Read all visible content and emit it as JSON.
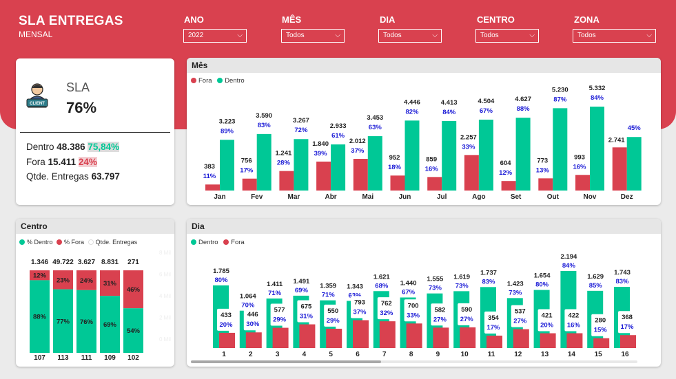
{
  "header": {
    "title": "SLA ENTREGAS",
    "subtitle": "MENSAL"
  },
  "filters": [
    {
      "label": "ANO",
      "value": "2022"
    },
    {
      "label": "MÊS",
      "value": "Todos"
    },
    {
      "label": "DIA",
      "value": "Todos"
    },
    {
      "label": "CENTRO",
      "value": "Todos"
    },
    {
      "label": "ZONA",
      "value": "Todos"
    }
  ],
  "kpi": {
    "label": "SLA",
    "value": "76%",
    "icon_text": "CLIENT",
    "dentro_label": "Dentro",
    "dentro_value": "48.386",
    "dentro_pct": "75,84%",
    "fora_label": "Fora",
    "fora_value": "15.411",
    "fora_pct": "24%",
    "total_label": "Qtde. Entregas",
    "total_value": "63.797"
  },
  "colors": {
    "dentro": "#00c896",
    "fora": "#d9414f",
    "pct": "#1a1ad6",
    "header": "#d9414f"
  },
  "month_panel": {
    "title": "Mês",
    "legend": [
      "Fora",
      "Dentro"
    ]
  },
  "centro_panel": {
    "title": "Centro",
    "legend": [
      "% Dentro",
      "% Fora",
      "Qtde. Entregas"
    ]
  },
  "day_panel": {
    "title": "Dia",
    "legend": [
      "Dentro",
      "Fora"
    ]
  },
  "chart_data": [
    {
      "type": "bar",
      "title": "Mês",
      "categories": [
        "Jan",
        "Fev",
        "Mar",
        "Abr",
        "Mai",
        "Jun",
        "Jul",
        "Ago",
        "Set",
        "Out",
        "Nov",
        "Dez"
      ],
      "series": [
        {
          "name": "Fora",
          "values": [
            383,
            756,
            1241,
            1840,
            2012,
            952,
            859,
            2257,
            604,
            773,
            993,
            2741
          ],
          "labels": [
            "383",
            "756",
            "1.241",
            "1.840",
            "2.012",
            "952",
            "859",
            "2.257",
            "604",
            "773",
            "993",
            "2.741"
          ],
          "pct": [
            "11%",
            "17%",
            "28%",
            "39%",
            "37%",
            "18%",
            "16%",
            "33%",
            "12%",
            "13%",
            "16%",
            ""
          ]
        },
        {
          "name": "Dentro",
          "values": [
            3223,
            3590,
            3267,
            2933,
            3453,
            4446,
            4413,
            4504,
            4627,
            5230,
            5332,
            3400
          ],
          "labels": [
            "3.223",
            "3.590",
            "3.267",
            "2.933",
            "3.453",
            "4.446",
            "4.413",
            "4.504",
            "4.627",
            "5.230",
            "5.332",
            ""
          ],
          "pct": [
            "89%",
            "83%",
            "72%",
            "61%",
            "63%",
            "82%",
            "84%",
            "67%",
            "88%",
            "87%",
            "84%",
            "45%"
          ]
        }
      ],
      "ylim": [
        0,
        5500
      ]
    },
    {
      "type": "bar",
      "title": "Centro",
      "categories": [
        "107",
        "113",
        "111",
        "109",
        "102"
      ],
      "totals": [
        "1.346",
        "49.722",
        "3.627",
        "8.831",
        "271"
      ],
      "series": [
        {
          "name": "% Dentro",
          "values": [
            88,
            77,
            76,
            69,
            54
          ],
          "labels": [
            "88%",
            "77%",
            "76%",
            "69%",
            "54%"
          ]
        },
        {
          "name": "% Fora",
          "values": [
            12,
            23,
            24,
            31,
            46
          ],
          "labels": [
            "12%",
            "23%",
            "24%",
            "31%",
            "46%"
          ]
        }
      ],
      "secondary_axis_ticks": [
        "8 Mil",
        "6 Mil",
        "4 Mil",
        "2 Mil",
        "0 Mil"
      ],
      "ylim": [
        0,
        100
      ]
    },
    {
      "type": "bar",
      "title": "Dia",
      "categories": [
        "1",
        "2",
        "3",
        "4",
        "5",
        "6",
        "7",
        "8",
        "9",
        "10",
        "11",
        "12",
        "13",
        "14",
        "15",
        "16"
      ],
      "series": [
        {
          "name": "Dentro",
          "values": [
            1785,
            1064,
            1411,
            1491,
            1359,
            1343,
            1621,
            1440,
            1555,
            1619,
            1737,
            1423,
            1654,
            2194,
            1629,
            1743
          ],
          "labels": [
            "1.785",
            "1.064",
            "1.411",
            "1.491",
            "1.359",
            "1.343",
            "1.621",
            "1.440",
            "1.555",
            "1.619",
            "1.737",
            "1.423",
            "1.654",
            "2.194",
            "1.629",
            "1.743"
          ],
          "pct": [
            "80%",
            "70%",
            "71%",
            "69%",
            "71%",
            "63%",
            "68%",
            "67%",
            "73%",
            "73%",
            "83%",
            "73%",
            "80%",
            "84%",
            "85%",
            "83%"
          ]
        },
        {
          "name": "Fora",
          "values": [
            433,
            446,
            577,
            675,
            550,
            793,
            762,
            700,
            582,
            590,
            354,
            537,
            421,
            422,
            280,
            368
          ],
          "labels": [
            "433",
            "446",
            "577",
            "675",
            "550",
            "793",
            "762",
            "700",
            "582",
            "590",
            "354",
            "537",
            "421",
            "422",
            "280",
            "368"
          ],
          "pct": [
            "20%",
            "30%",
            "29%",
            "31%",
            "29%",
            "37%",
            "32%",
            "33%",
            "27%",
            "27%",
            "17%",
            "27%",
            "20%",
            "16%",
            "15%",
            "17%"
          ]
        }
      ],
      "ylim": [
        0,
        2300
      ]
    }
  ]
}
